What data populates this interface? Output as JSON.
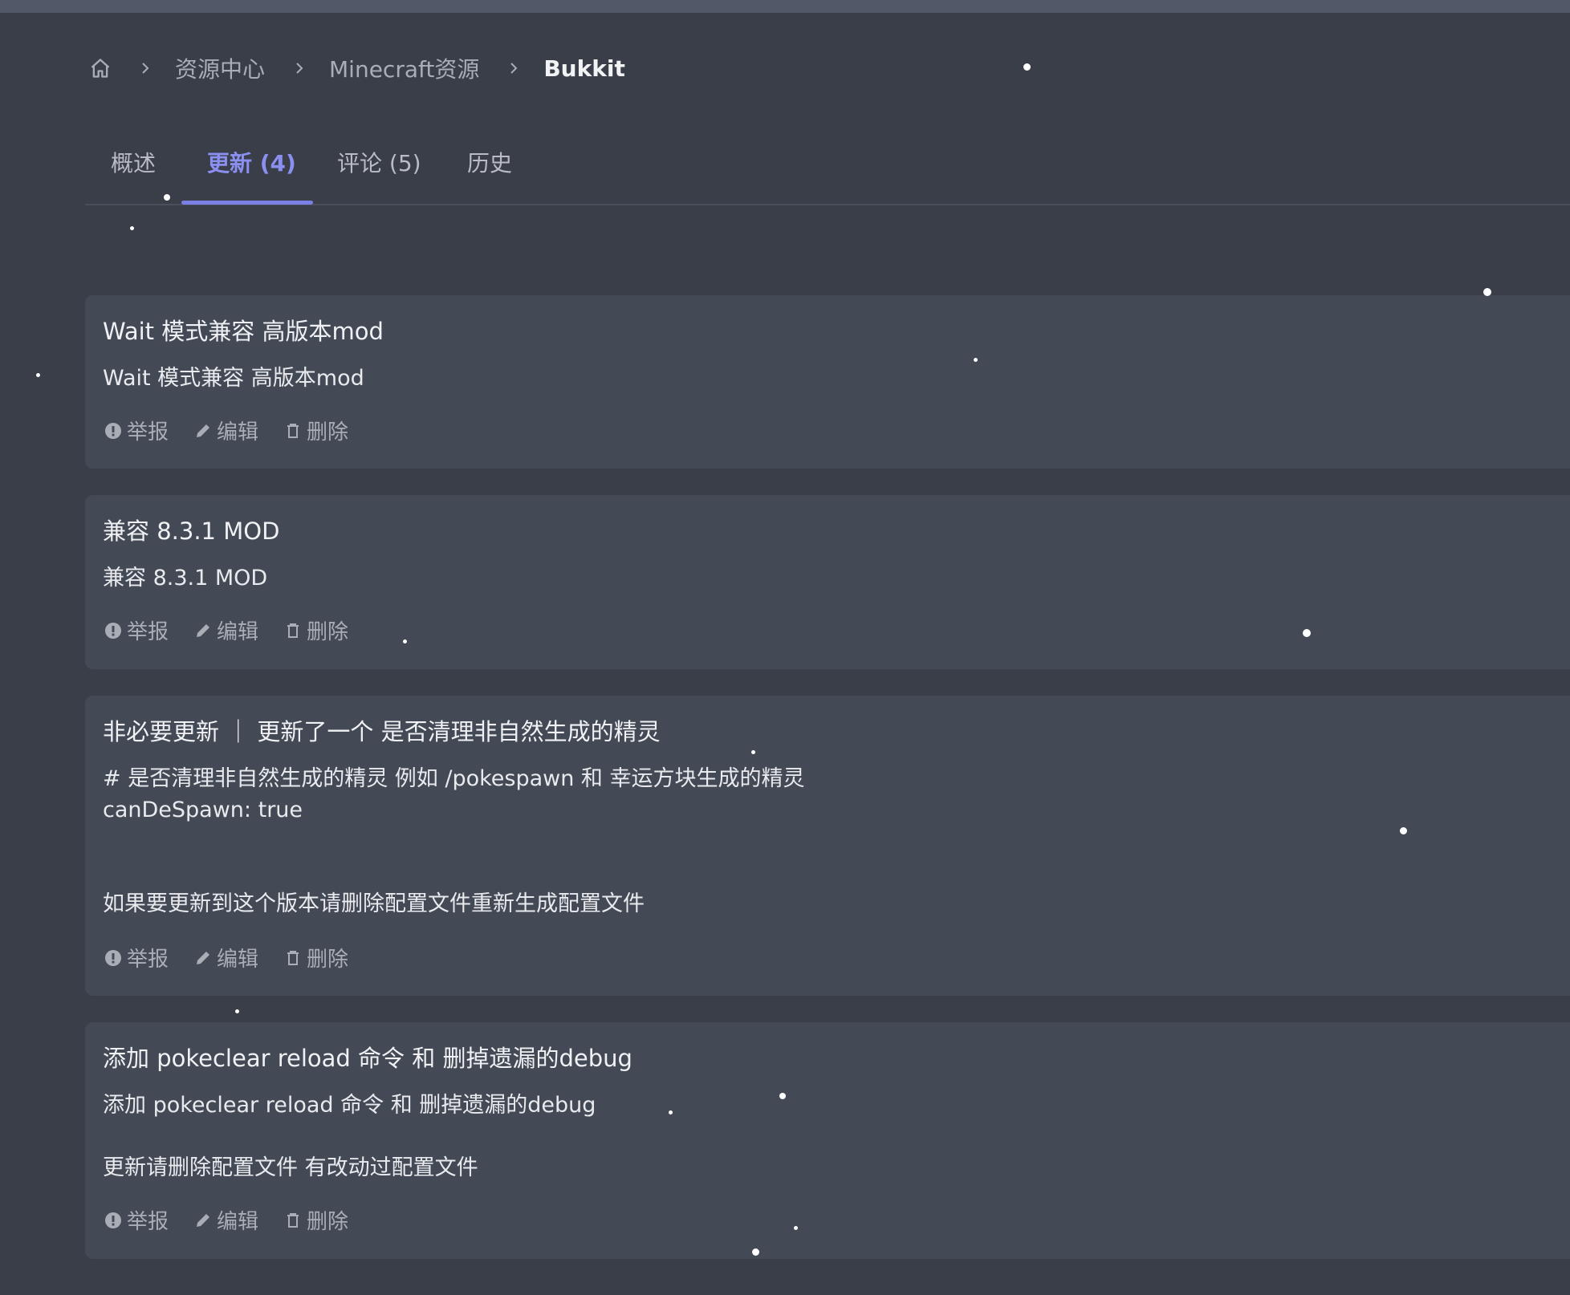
{
  "breadcrumb": {
    "home_icon": "home-icon",
    "separator_icon": "chevron-right-icon",
    "items": [
      "资源中心",
      "Minecraft资源"
    ],
    "current": "Bukkit"
  },
  "tabs": [
    {
      "label": "概述",
      "active": false
    },
    {
      "label": "更新 (4)",
      "active": true
    },
    {
      "label": "评论 (5)",
      "active": false
    },
    {
      "label": "历史",
      "active": false
    }
  ],
  "actions": {
    "report": "举报",
    "edit": "编辑",
    "delete": "删除",
    "report_icon": "alert-circle-icon",
    "edit_icon": "pencil-icon",
    "delete_icon": "trash-icon"
  },
  "updates": [
    {
      "title": "Wait 模式兼容 高版本mod",
      "body": "Wait 模式兼容 高版本mod"
    },
    {
      "title": "兼容 8.3.1 MOD",
      "body": "兼容 8.3.1 MOD"
    },
    {
      "title": "非必要更新 ｜ 更新了一个 是否清理非自然生成的精灵",
      "body": "# 是否清理非自然生成的精灵 例如 /pokespawn 和 幸运方块生成的精灵\ncanDeSpawn: true\n\n\n如果要更新到这个版本请删除配置文件重新生成配置文件"
    },
    {
      "title": "添加 pokeclear reload 命令 和 删掉遗漏的debug",
      "body": "添加 pokeclear reload 命令 和 删掉遗漏的debug\n\n更新请删除配置文件 有改动过配置文件"
    }
  ],
  "colors": {
    "background": "#3a3e48",
    "card": "#444a55",
    "accent": "#7b80e6",
    "muted": "#a9adb6"
  }
}
